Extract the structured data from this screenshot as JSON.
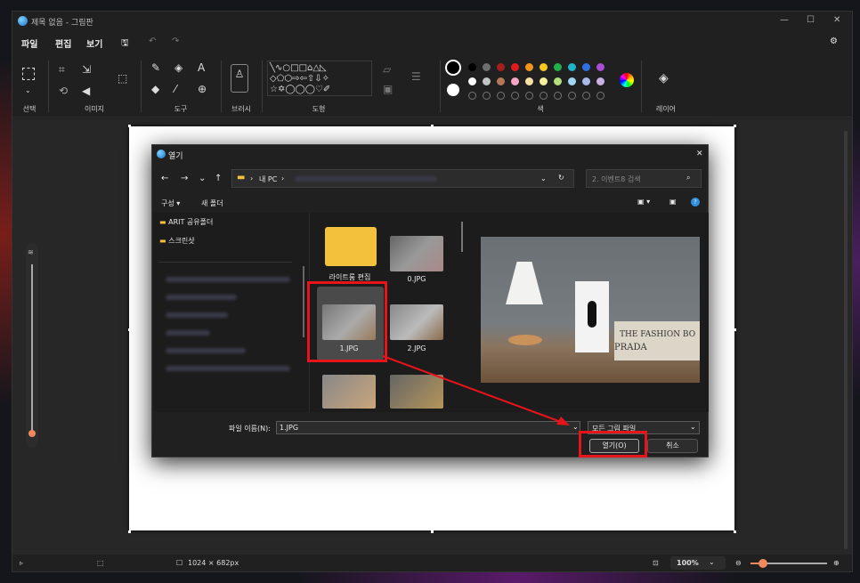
{
  "window": {
    "title": "제목 없음 - 그림판"
  },
  "menu": {
    "file": "파일",
    "edit": "편집",
    "view": "보기"
  },
  "ribbon": {
    "selection": "선택",
    "image": "이미지",
    "tools": "도구",
    "brushes": "브러시",
    "shapes": "도형",
    "colors": "색",
    "layers": "레이어"
  },
  "colors": {
    "row1": [
      "#000000",
      "#6e6e6e",
      "#a61e1e",
      "#e21c1c",
      "#f1941e",
      "#f7c91e",
      "#22b04a",
      "#1fb3c8",
      "#2f6fe0",
      "#a64fd0"
    ],
    "row2": [
      "#ffffff",
      "#c3c3c3",
      "#b4785a",
      "#f7a6c4",
      "#f7e0a6",
      "#f5f0a0",
      "#b3e07a",
      "#9ed8f0",
      "#a9b8e8",
      "#c8b0e0"
    ],
    "primary": "#000000",
    "secondary": "#ffffff"
  },
  "status": {
    "canvas_size": "1024 × 682px",
    "zoom": "100%"
  },
  "dialog": {
    "title": "열기",
    "breadcrumb": "내 PC",
    "search_placeholder": "2. 이벤트8 검색",
    "organize": "구성 ▾",
    "new_folder": "새 폴더",
    "nav_items": [
      "ARIT 공유폴더",
      "스크린샷"
    ],
    "files": [
      {
        "name": "라이트룸 편집",
        "type": "folder"
      },
      {
        "name": "0.JPG",
        "type": "image"
      },
      {
        "name": "1.JPG",
        "type": "image",
        "selected": true
      },
      {
        "name": "2.JPG",
        "type": "image"
      }
    ],
    "filename_label": "파일 이름(N):",
    "filename_value": "1.JPG",
    "filetype": "모든 그림 파일",
    "open_button": "열기(O)",
    "cancel_button": "취소",
    "preview_texts": [
      "THE FASHION BO",
      "PRADA"
    ]
  }
}
